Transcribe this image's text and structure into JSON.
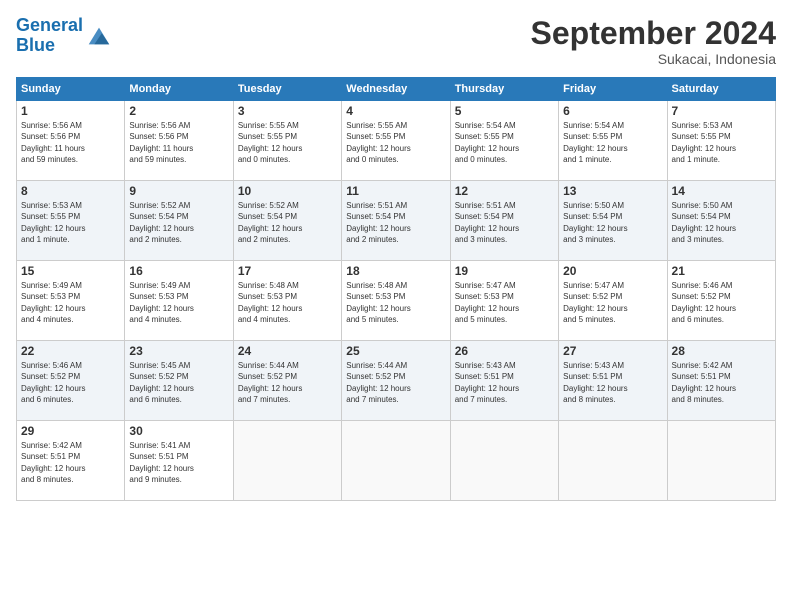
{
  "header": {
    "logo_line1": "General",
    "logo_line2": "Blue",
    "month_title": "September 2024",
    "location": "Sukacai, Indonesia"
  },
  "weekdays": [
    "Sunday",
    "Monday",
    "Tuesday",
    "Wednesday",
    "Thursday",
    "Friday",
    "Saturday"
  ],
  "weeks": [
    [
      {
        "day": "1",
        "info": "Sunrise: 5:56 AM\nSunset: 5:56 PM\nDaylight: 11 hours\nand 59 minutes."
      },
      {
        "day": "2",
        "info": "Sunrise: 5:56 AM\nSunset: 5:56 PM\nDaylight: 11 hours\nand 59 minutes."
      },
      {
        "day": "3",
        "info": "Sunrise: 5:55 AM\nSunset: 5:55 PM\nDaylight: 12 hours\nand 0 minutes."
      },
      {
        "day": "4",
        "info": "Sunrise: 5:55 AM\nSunset: 5:55 PM\nDaylight: 12 hours\nand 0 minutes."
      },
      {
        "day": "5",
        "info": "Sunrise: 5:54 AM\nSunset: 5:55 PM\nDaylight: 12 hours\nand 0 minutes."
      },
      {
        "day": "6",
        "info": "Sunrise: 5:54 AM\nSunset: 5:55 PM\nDaylight: 12 hours\nand 1 minute."
      },
      {
        "day": "7",
        "info": "Sunrise: 5:53 AM\nSunset: 5:55 PM\nDaylight: 12 hours\nand 1 minute."
      }
    ],
    [
      {
        "day": "8",
        "info": "Sunrise: 5:53 AM\nSunset: 5:55 PM\nDaylight: 12 hours\nand 1 minute."
      },
      {
        "day": "9",
        "info": "Sunrise: 5:52 AM\nSunset: 5:54 PM\nDaylight: 12 hours\nand 2 minutes."
      },
      {
        "day": "10",
        "info": "Sunrise: 5:52 AM\nSunset: 5:54 PM\nDaylight: 12 hours\nand 2 minutes."
      },
      {
        "day": "11",
        "info": "Sunrise: 5:51 AM\nSunset: 5:54 PM\nDaylight: 12 hours\nand 2 minutes."
      },
      {
        "day": "12",
        "info": "Sunrise: 5:51 AM\nSunset: 5:54 PM\nDaylight: 12 hours\nand 3 minutes."
      },
      {
        "day": "13",
        "info": "Sunrise: 5:50 AM\nSunset: 5:54 PM\nDaylight: 12 hours\nand 3 minutes."
      },
      {
        "day": "14",
        "info": "Sunrise: 5:50 AM\nSunset: 5:54 PM\nDaylight: 12 hours\nand 3 minutes."
      }
    ],
    [
      {
        "day": "15",
        "info": "Sunrise: 5:49 AM\nSunset: 5:53 PM\nDaylight: 12 hours\nand 4 minutes."
      },
      {
        "day": "16",
        "info": "Sunrise: 5:49 AM\nSunset: 5:53 PM\nDaylight: 12 hours\nand 4 minutes."
      },
      {
        "day": "17",
        "info": "Sunrise: 5:48 AM\nSunset: 5:53 PM\nDaylight: 12 hours\nand 4 minutes."
      },
      {
        "day": "18",
        "info": "Sunrise: 5:48 AM\nSunset: 5:53 PM\nDaylight: 12 hours\nand 5 minutes."
      },
      {
        "day": "19",
        "info": "Sunrise: 5:47 AM\nSunset: 5:53 PM\nDaylight: 12 hours\nand 5 minutes."
      },
      {
        "day": "20",
        "info": "Sunrise: 5:47 AM\nSunset: 5:52 PM\nDaylight: 12 hours\nand 5 minutes."
      },
      {
        "day": "21",
        "info": "Sunrise: 5:46 AM\nSunset: 5:52 PM\nDaylight: 12 hours\nand 6 minutes."
      }
    ],
    [
      {
        "day": "22",
        "info": "Sunrise: 5:46 AM\nSunset: 5:52 PM\nDaylight: 12 hours\nand 6 minutes."
      },
      {
        "day": "23",
        "info": "Sunrise: 5:45 AM\nSunset: 5:52 PM\nDaylight: 12 hours\nand 6 minutes."
      },
      {
        "day": "24",
        "info": "Sunrise: 5:44 AM\nSunset: 5:52 PM\nDaylight: 12 hours\nand 7 minutes."
      },
      {
        "day": "25",
        "info": "Sunrise: 5:44 AM\nSunset: 5:52 PM\nDaylight: 12 hours\nand 7 minutes."
      },
      {
        "day": "26",
        "info": "Sunrise: 5:43 AM\nSunset: 5:51 PM\nDaylight: 12 hours\nand 7 minutes."
      },
      {
        "day": "27",
        "info": "Sunrise: 5:43 AM\nSunset: 5:51 PM\nDaylight: 12 hours\nand 8 minutes."
      },
      {
        "day": "28",
        "info": "Sunrise: 5:42 AM\nSunset: 5:51 PM\nDaylight: 12 hours\nand 8 minutes."
      }
    ],
    [
      {
        "day": "29",
        "info": "Sunrise: 5:42 AM\nSunset: 5:51 PM\nDaylight: 12 hours\nand 8 minutes."
      },
      {
        "day": "30",
        "info": "Sunrise: 5:41 AM\nSunset: 5:51 PM\nDaylight: 12 hours\nand 9 minutes."
      },
      {
        "day": "",
        "info": ""
      },
      {
        "day": "",
        "info": ""
      },
      {
        "day": "",
        "info": ""
      },
      {
        "day": "",
        "info": ""
      },
      {
        "day": "",
        "info": ""
      }
    ]
  ]
}
